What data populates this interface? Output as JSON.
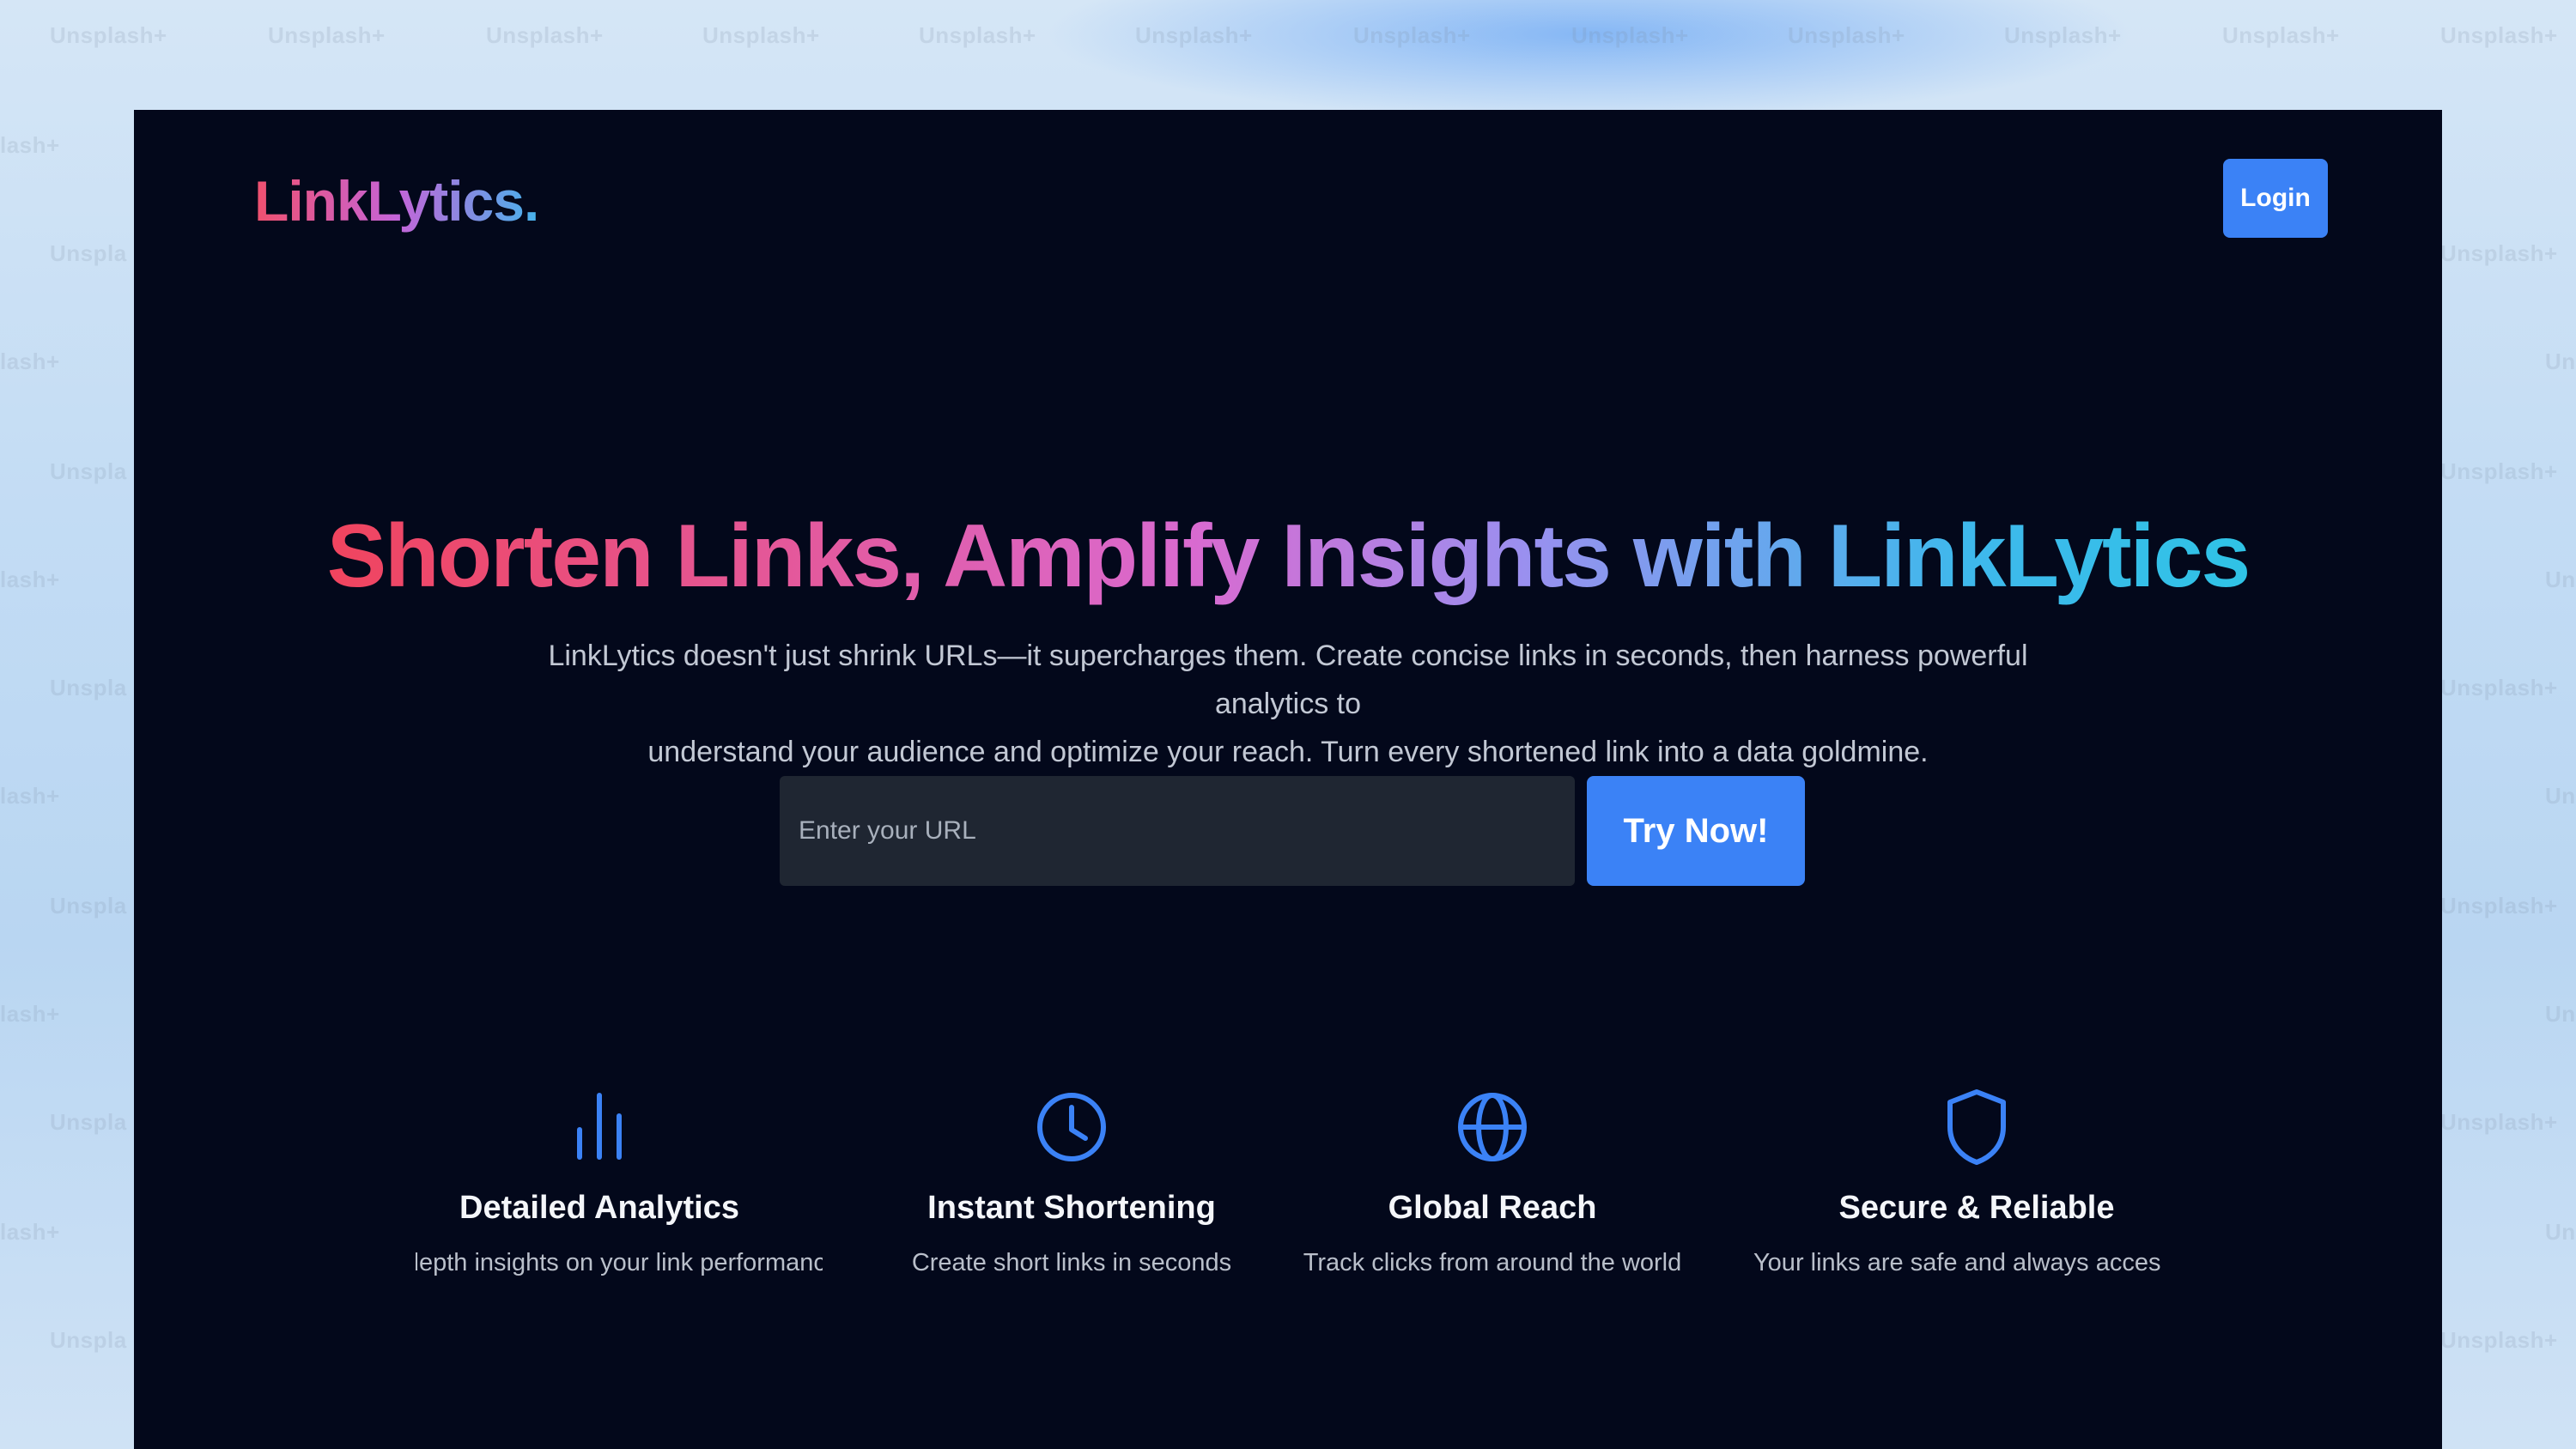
{
  "watermark": "Unsplash+",
  "watermark_partial": "lash+",
  "watermark_edge": "Un",
  "watermark_left": "Unspla",
  "app": {
    "logo": "LinkLytics.",
    "login_label": "Login"
  },
  "hero": {
    "headline": "Shorten Links, Amplify Insights with LinkLytics",
    "subtitle_line1": "LinkLytics doesn't just shrink URLs—it supercharges them. Create concise links in seconds, then harness powerful analytics to",
    "subtitle_line2": "understand your audience and optimize your reach. Turn every shortened link into a data goldmine."
  },
  "shortener": {
    "placeholder": "Enter your URL",
    "value": "",
    "button_label": "Try Now!"
  },
  "features": [
    {
      "icon": "bar-chart-icon",
      "title": "Detailed Analytics",
      "description": "In-depth insights on your link performance"
    },
    {
      "icon": "clock-icon",
      "title": "Instant Shortening",
      "description": "Create short links in seconds"
    },
    {
      "icon": "globe-icon",
      "title": "Global Reach",
      "description": "Track clicks from around the world"
    },
    {
      "icon": "shield-icon",
      "title": "Secure & Reliable",
      "description": "Your links are safe and always accessible"
    }
  ],
  "colors": {
    "accent": "#3b82f6",
    "background": "#03081b",
    "gradient_start": "#f0445e",
    "gradient_end": "#2fc3e6"
  }
}
